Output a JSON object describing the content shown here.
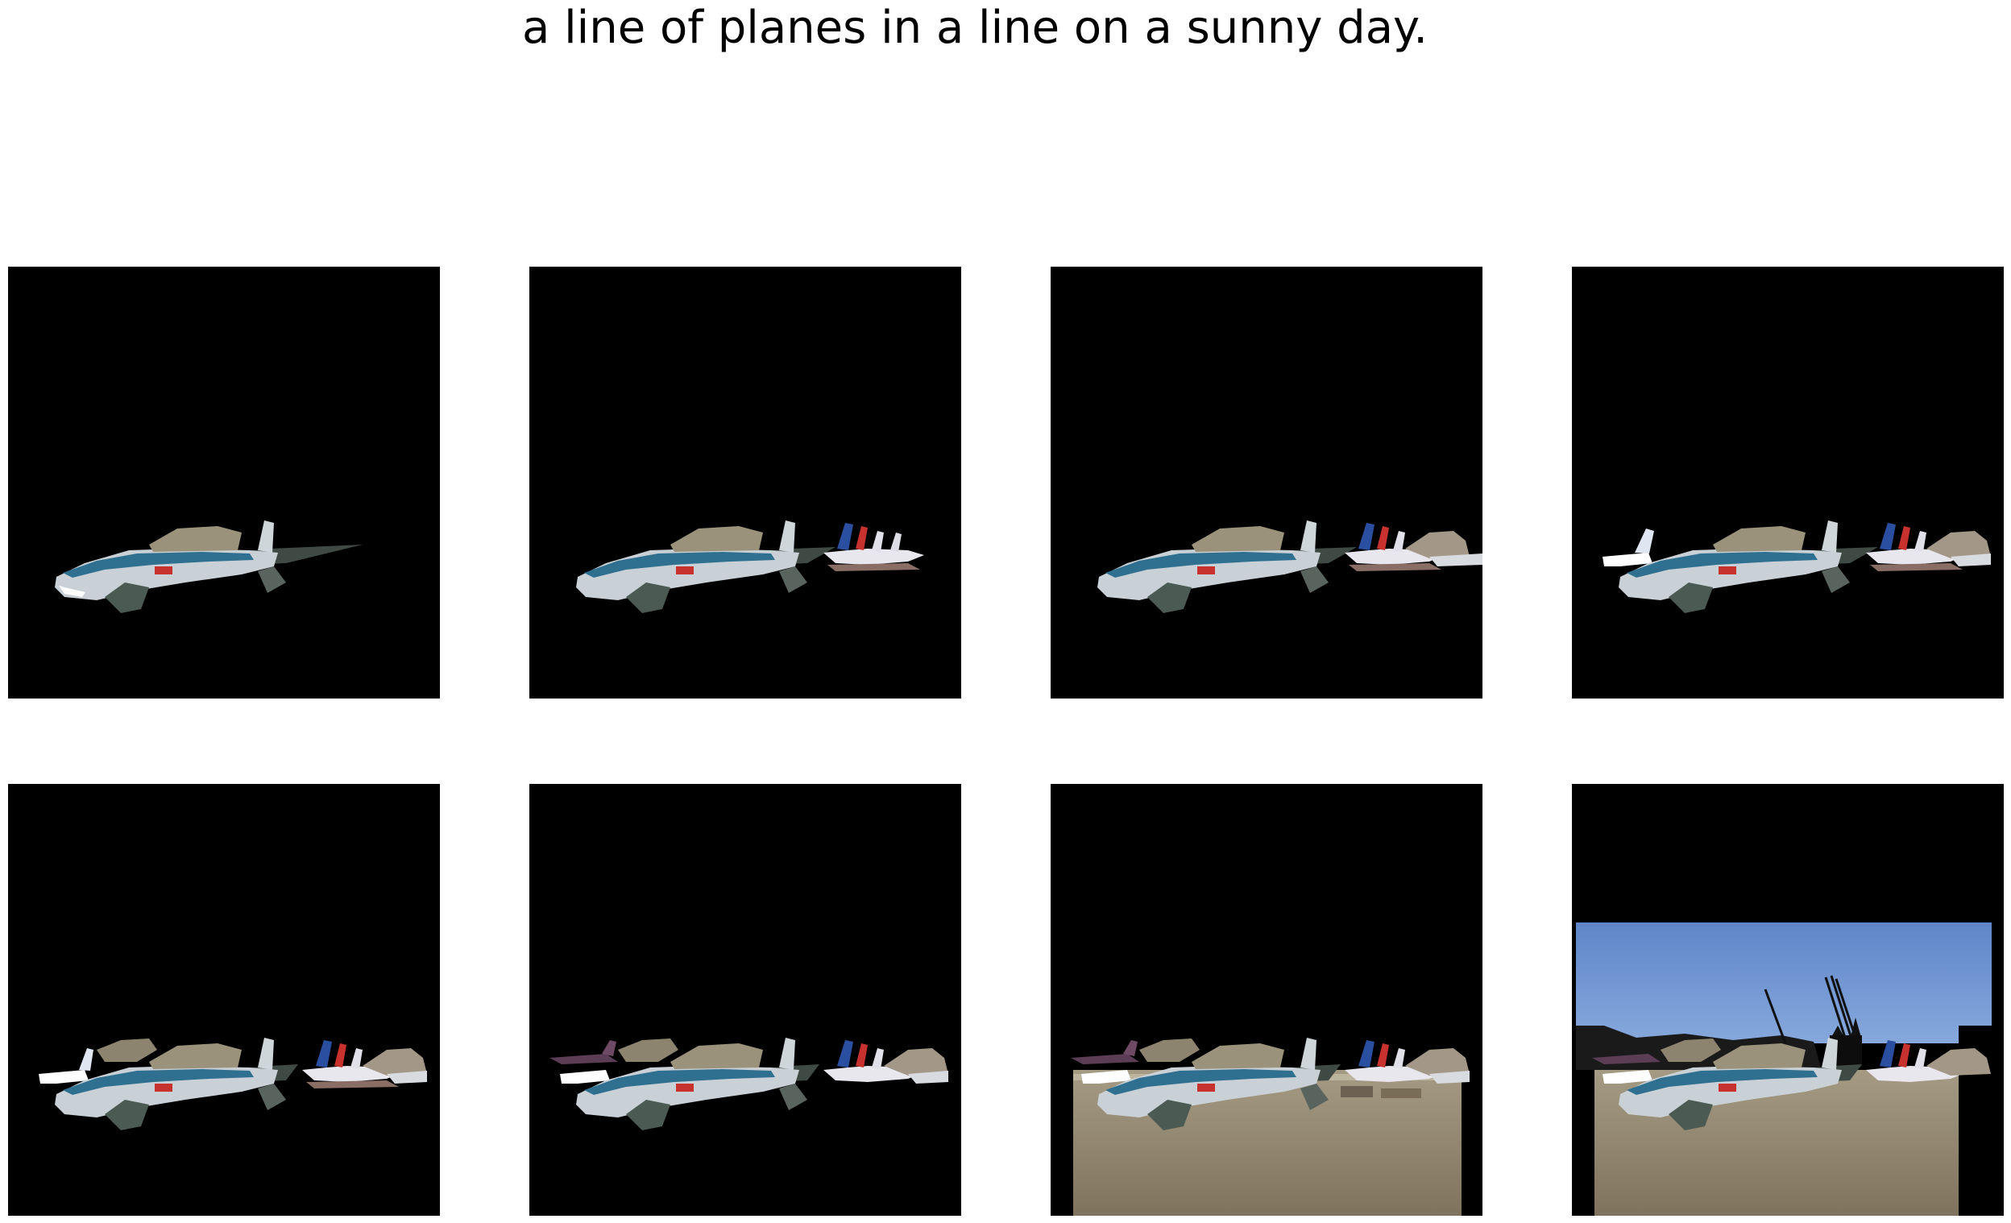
{
  "caption": "a line of planes in a line on a sunny day.",
  "panels": [
    {
      "step": 1,
      "layers": [
        "shark-nose-jet"
      ]
    },
    {
      "step": 2,
      "layers": [
        "shark-nose-jet",
        "formation-jets-right"
      ]
    },
    {
      "step": 3,
      "layers": [
        "shark-nose-jet",
        "formation-jets-right",
        "tan-jet-right"
      ]
    },
    {
      "step": 4,
      "layers": [
        "shark-nose-jet",
        "formation-jets-right",
        "tan-jet-right",
        "white-jet-left"
      ]
    },
    {
      "step": 5,
      "layers": [
        "shark-nose-jet",
        "formation-jets-right",
        "tan-jet-right",
        "white-jet-left",
        "tan-jet-left"
      ]
    },
    {
      "step": 6,
      "layers": [
        "shark-nose-jet",
        "formation-jets-right",
        "tan-jet-right",
        "white-jet-left",
        "tan-jet-left",
        "maroon-jet-left"
      ]
    },
    {
      "step": 7,
      "layers": [
        "shark-nose-jet",
        "formation-jets-right",
        "tan-jet-right",
        "white-jet-left",
        "tan-jet-left",
        "maroon-jet-left",
        "tarmac-ground"
      ]
    },
    {
      "step": 8,
      "layers": [
        "shark-nose-jet",
        "formation-jets-right",
        "tan-jet-right",
        "white-jet-left",
        "tan-jet-left",
        "maroon-jet-left",
        "tarmac-ground",
        "blue-sky"
      ]
    }
  ],
  "colors": {
    "background": "#000000",
    "sky": "#6f95d1",
    "tarmac": "#9b9078",
    "jet_body": "#c9d1d6",
    "jet_stripe": "#2f6f90",
    "tail_red": "#c8322e",
    "tail_blue": "#2b4fa0"
  }
}
